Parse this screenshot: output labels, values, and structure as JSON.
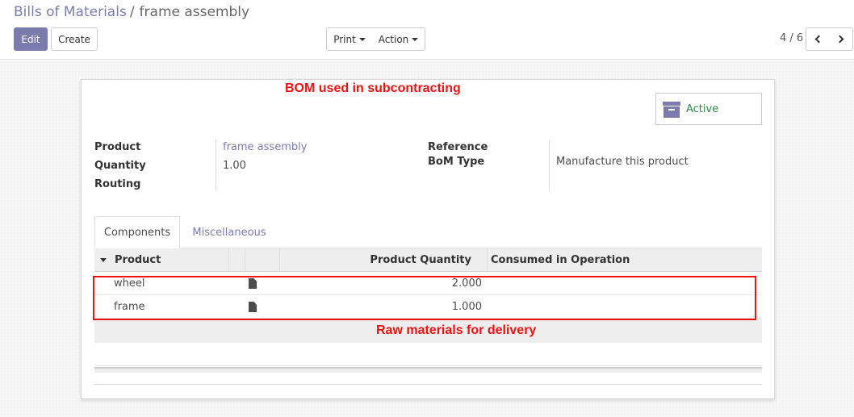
{
  "breadcrumb": {
    "parent": "Bills of Materials",
    "separator": "/",
    "current": "frame assembly"
  },
  "toolbar": {
    "edit_label": "Edit",
    "create_label": "Create",
    "print_label": "Print",
    "action_label": "Action"
  },
  "pager": {
    "value": "4 / 6"
  },
  "annotations": {
    "top": "BOM used in subcontracting",
    "bottom": "Raw materials for delivery"
  },
  "smart_button": {
    "label": "Active",
    "icon": "archive-icon"
  },
  "fields": {
    "product_label": "Product",
    "product_value": "frame assembly",
    "quantity_label": "Quantity",
    "quantity_value": "1.00",
    "routing_label": "Routing",
    "reference_label": "Reference",
    "bom_type_label": "BoM Type",
    "bom_type_value": "Manufacture this product"
  },
  "tabs": [
    {
      "label": "Components",
      "active": true
    },
    {
      "label": "Miscellaneous",
      "active": false
    }
  ],
  "table": {
    "columns": [
      "Product",
      "Product Quantity",
      "Consumed in Operation"
    ],
    "rows": [
      {
        "product": "wheel",
        "quantity": "2.000",
        "operation": ""
      },
      {
        "product": "frame",
        "quantity": "1.000",
        "operation": ""
      }
    ]
  },
  "colors": {
    "brand": "#7c7bad",
    "annotation": "#ee1111",
    "active": "#2e8a44"
  }
}
